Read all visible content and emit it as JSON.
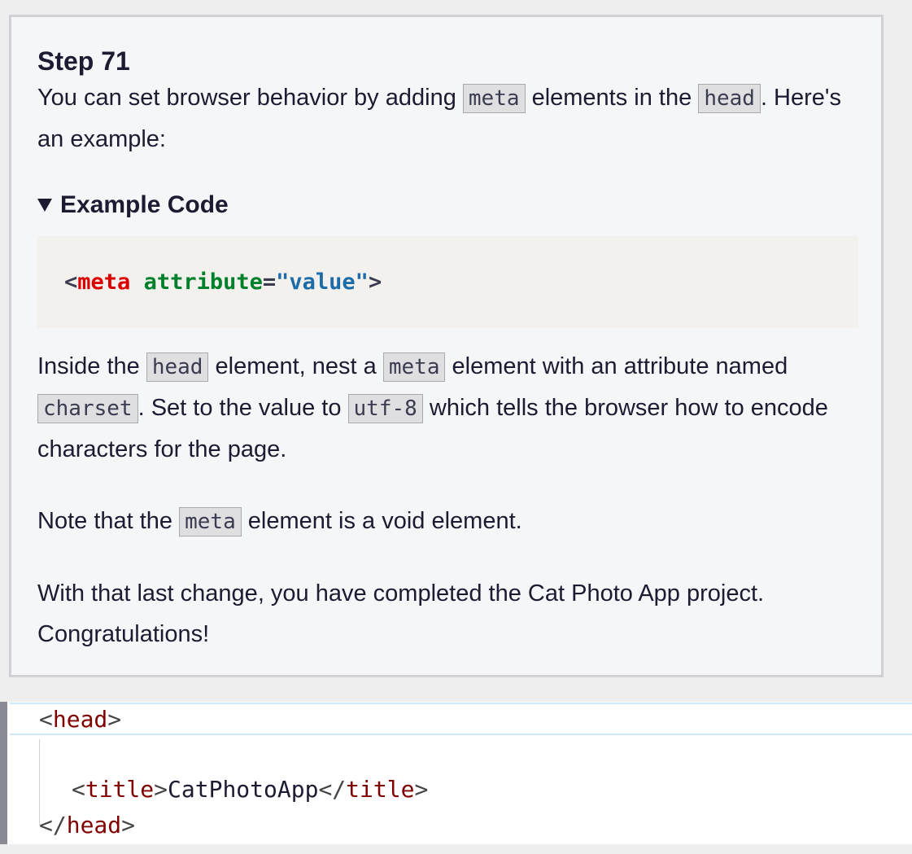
{
  "lesson": {
    "step_title": "Step 71",
    "intro": {
      "t1": "You can set browser behavior by adding ",
      "c1": "meta",
      "t2": " elements in the ",
      "c2": "head",
      "t3": ". Here's an example:"
    },
    "example_summary": "Example Code",
    "example_code": {
      "open": "<",
      "tag": "meta",
      "space": " ",
      "attr": "attribute",
      "eq": "=",
      "value": "\"value\"",
      "close": ">"
    },
    "instruction": {
      "t1": "Inside the ",
      "c1": "head",
      "t2": " element, nest a ",
      "c2": "meta",
      "t3": " element with an attribute named ",
      "c3": "charset",
      "t4": ". Set to the value to ",
      "c4": "utf-8",
      "t5": " which tells the browser how to encode characters for the page."
    },
    "note": {
      "t1": "Note that the ",
      "c1": "meta",
      "t2": " element is a void element."
    },
    "closing": "With that last change, you have completed the Cat Photo App project. Congratulations!"
  },
  "editor": {
    "line1": {
      "lt": "<",
      "tag": "head",
      "gt": ">"
    },
    "line3": {
      "lt": "<",
      "tag": "title",
      "gt": ">",
      "text": "CatPhotoApp",
      "lt2": "</",
      "tag2": "title",
      "gt2": ">"
    },
    "line4": {
      "lt": "</",
      "tag": "head",
      "gt": ">"
    }
  }
}
